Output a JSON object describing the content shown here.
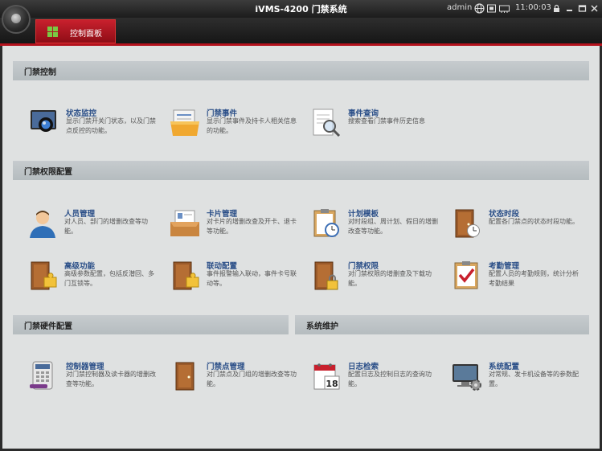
{
  "window": {
    "title": "iVMS-4200  门禁系统",
    "user": "admin",
    "clock": "11:00:03",
    "status_icons": [
      "globe-icon",
      "cpu-icon",
      "ram-icon"
    ],
    "buttons": [
      "lock-icon",
      "minimize-icon",
      "maximize-icon",
      "close-icon"
    ]
  },
  "tabs": [
    {
      "label": "控制面板"
    }
  ],
  "sections": {
    "access_control": {
      "title": "门禁控制",
      "items": [
        {
          "title": "状态监控",
          "desc": "显示门禁开关门状态，以及门禁点反控的功能。"
        },
        {
          "title": "门禁事件",
          "desc": "显示门禁事件及持卡人相关信息的功能。"
        },
        {
          "title": "事件查询",
          "desc": "搜索查看门禁事件历史信息"
        }
      ]
    },
    "permission_config": {
      "title": "门禁权限配置",
      "items": [
        {
          "title": "人员管理",
          "desc": "对人员、部门的增删改查等功能。"
        },
        {
          "title": "卡片管理",
          "desc": "对卡片的增删改查及开卡、退卡等功能。"
        },
        {
          "title": "计划模板",
          "desc": "对时段组、周计划、假日的增删改查等功能。"
        },
        {
          "title": "状态时段",
          "desc": "配置各门禁点的状态时段功能。"
        },
        {
          "title": "高级功能",
          "desc": "高级参数配置，包括反潜回、多门互锁等。"
        },
        {
          "title": "联动配置",
          "desc": "事件报警输入联动，事件卡号联动等。"
        },
        {
          "title": "门禁权限",
          "desc": "对门禁权限的增删查及下载功能。"
        },
        {
          "title": "考勤管理",
          "desc": "配置人员的考勤规则，统计分析考勤结果"
        }
      ]
    },
    "hardware_config": {
      "title": "门禁硬件配置",
      "items": [
        {
          "title": "控制器管理",
          "desc": "对门禁控制器及读卡器的增删改查等功能。"
        },
        {
          "title": "门禁点管理",
          "desc": "对门禁点及门组的增删改查等功能。"
        }
      ]
    },
    "maintenance": {
      "title": "系统维护",
      "items": [
        {
          "title": "日志检索",
          "desc": "配置日志及控制日志的查询功能。"
        },
        {
          "title": "系统配置",
          "desc": "对常规、发卡机设备等的参数配置。"
        }
      ]
    }
  },
  "colors": {
    "accent": "#b4121d",
    "link": "#2b4f88",
    "content_bg": "#dfe1e1",
    "header_bg": "#c1c6c9"
  }
}
